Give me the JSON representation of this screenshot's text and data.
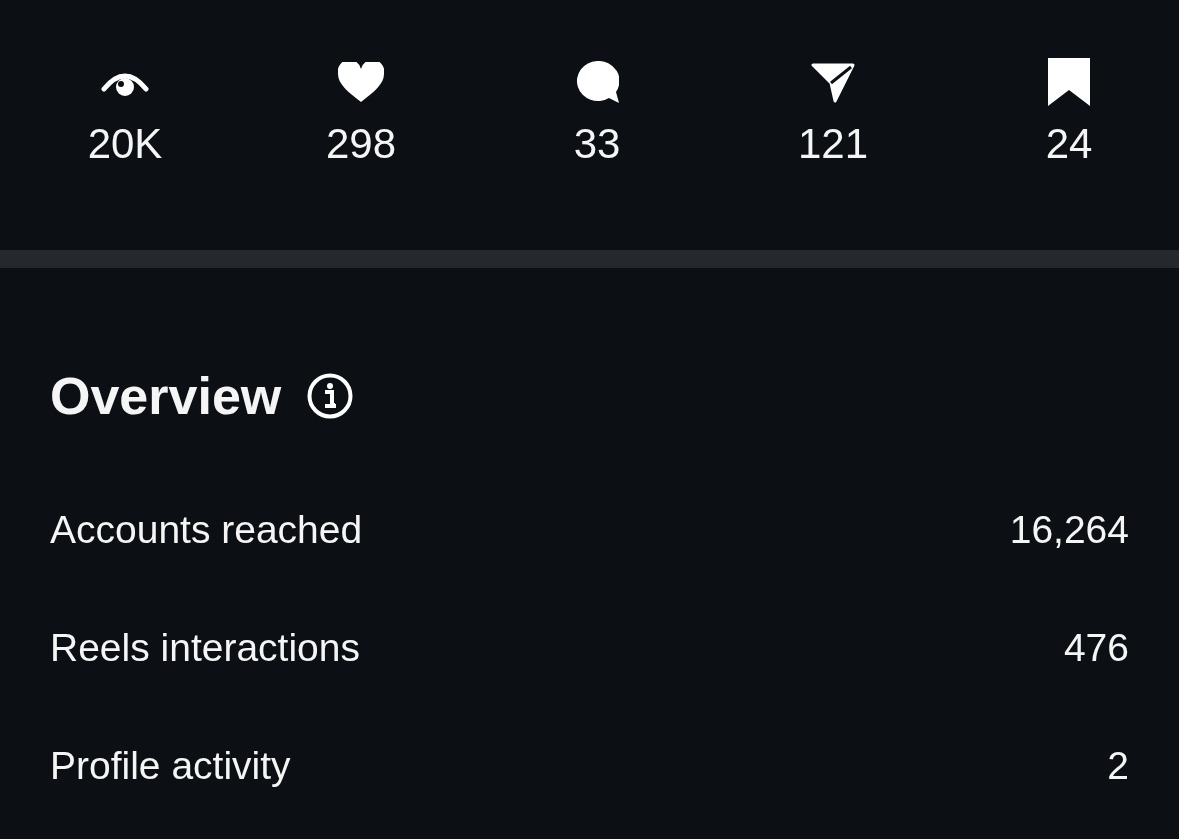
{
  "stats": [
    {
      "kind": "views",
      "value": "20K"
    },
    {
      "kind": "likes",
      "value": "298"
    },
    {
      "kind": "comments",
      "value": "33"
    },
    {
      "kind": "shares",
      "value": "121"
    },
    {
      "kind": "saves",
      "value": "24"
    }
  ],
  "overview": {
    "title": "Overview",
    "rows": [
      {
        "label": "Accounts reached",
        "value": "16,264"
      },
      {
        "label": "Reels interactions",
        "value": "476"
      },
      {
        "label": "Profile activity",
        "value": "2"
      }
    ]
  }
}
